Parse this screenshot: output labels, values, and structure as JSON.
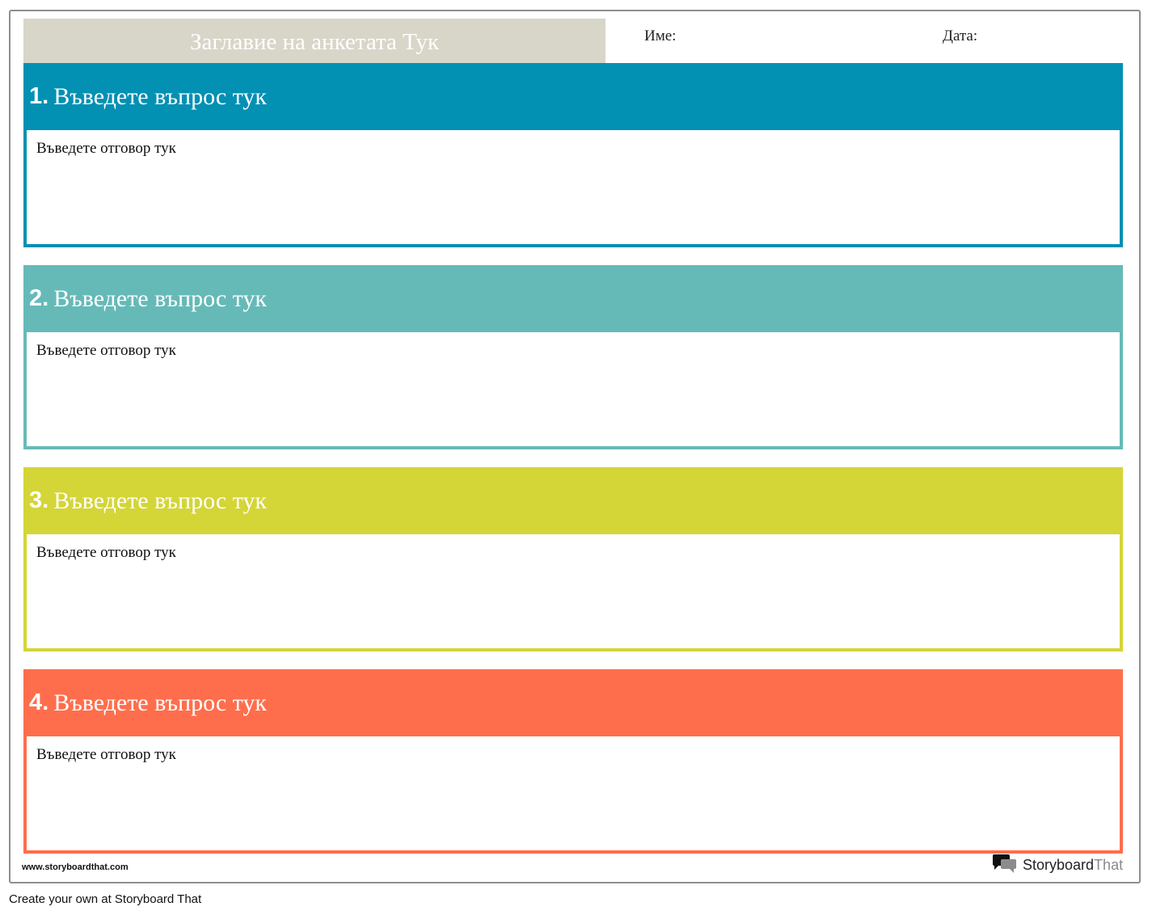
{
  "header": {
    "survey_title": "Заглавие на анкетата Тук",
    "name_label": "Име:",
    "date_label": "Дата:"
  },
  "questions": [
    {
      "number": "1.",
      "text": "Въведете въпрос тук",
      "answer": "Въведете отговор тук",
      "color": "#0290b3"
    },
    {
      "number": "2.",
      "text": "Въведете въпрос тук",
      "answer": "Въведете отговор тук",
      "color": "#65bab8"
    },
    {
      "number": "3.",
      "text": "Въведете въпрос тук",
      "answer": "Въведете отговор тук",
      "color": "#d4d537"
    },
    {
      "number": "4.",
      "text": "Въведете въпрос тук",
      "answer": "Въведете отговор тук",
      "color": "#ff6e4c"
    }
  ],
  "branding": {
    "website": "www.storyboardthat.com",
    "logo_part1": "Storyboard",
    "logo_part2": "That",
    "logo_icon": "speech-bubbles-icon"
  },
  "footer": {
    "cta": "Create your own at Storyboard That"
  }
}
